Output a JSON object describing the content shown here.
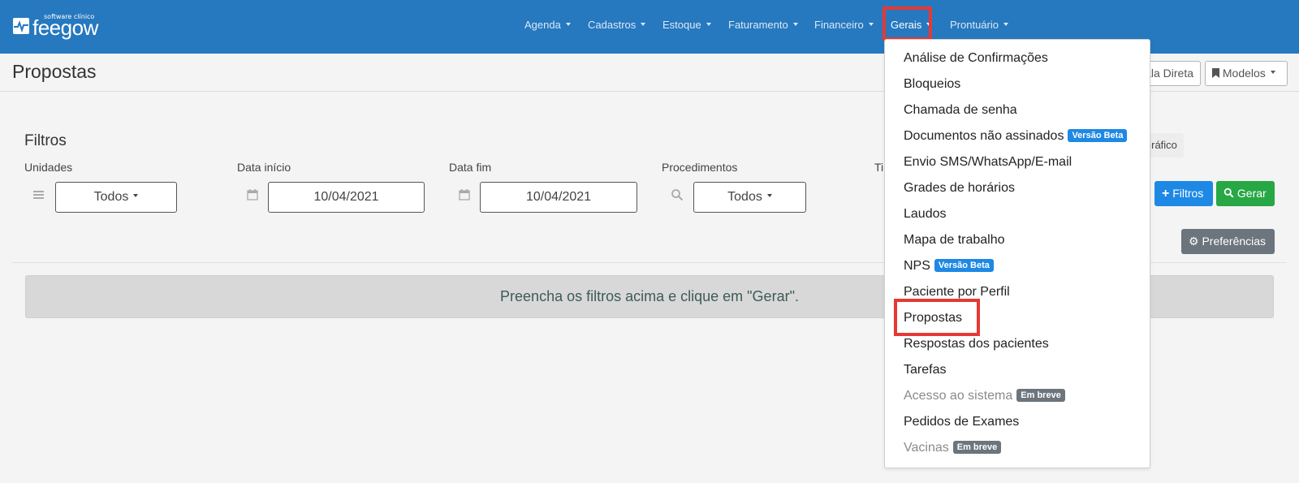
{
  "logo": {
    "subtitle": "software clínico",
    "name": "feegow"
  },
  "nav": {
    "items": [
      {
        "label": "Agenda"
      },
      {
        "label": "Cadastros"
      },
      {
        "label": "Estoque"
      },
      {
        "label": "Faturamento"
      },
      {
        "label": "Financeiro"
      },
      {
        "label": "Gerais",
        "active": true
      },
      {
        "label": "Prontuário"
      }
    ]
  },
  "page": {
    "title": "Propostas"
  },
  "header_buttons": {
    "sala_direta": "Sala Direta",
    "modelos": "Modelos"
  },
  "filters": {
    "title": "Filtros",
    "unidades": {
      "label": "Unidades",
      "value": "Todos"
    },
    "data_inicio": {
      "label": "Data início",
      "value": "10/04/2021"
    },
    "data_fim": {
      "label": "Data fim",
      "value": "10/04/2021"
    },
    "procedimentos": {
      "label": "Procedimentos",
      "value": "Todos"
    },
    "tipo_partial": "Ti",
    "grafico_label": "Gráfico",
    "add_filter_button": "Filtros",
    "generate_button": "Gerar",
    "preferences_button": "Preferências"
  },
  "alert": {
    "text": "Preencha os filtros acima e clique em \"Gerar\"."
  },
  "dropdown": {
    "items": [
      {
        "label": "Análise de Confirmações"
      },
      {
        "label": "Bloqueios"
      },
      {
        "label": "Chamada de senha"
      },
      {
        "label": "Documentos não assinados",
        "badge": "Versão Beta",
        "badge_color": "#1e88e5"
      },
      {
        "label": "Envio SMS/WhatsApp/E-mail"
      },
      {
        "label": "Grades de horários"
      },
      {
        "label": "Laudos"
      },
      {
        "label": "Mapa de trabalho"
      },
      {
        "label": "NPS",
        "badge": "Versão Beta",
        "badge_color": "#1e88e5"
      },
      {
        "label": "Paciente por Perfil"
      },
      {
        "label": "Propostas",
        "highlighted": true
      },
      {
        "label": "Respostas dos pacientes"
      },
      {
        "label": "Tarefas"
      },
      {
        "label": "Acesso ao sistema",
        "badge": "Em breve",
        "badge_color": "#6c757d",
        "disabled": true
      },
      {
        "label": "Pedidos de Exames"
      },
      {
        "label": "Vacinas",
        "badge": "Em breve",
        "badge_color": "#6c757d",
        "disabled": true
      }
    ]
  },
  "colors": {
    "navbar": "#2678bf",
    "highlight": "#e53935",
    "primary": "#1e88e5",
    "success": "#28a745",
    "secondary": "#6c757d"
  }
}
